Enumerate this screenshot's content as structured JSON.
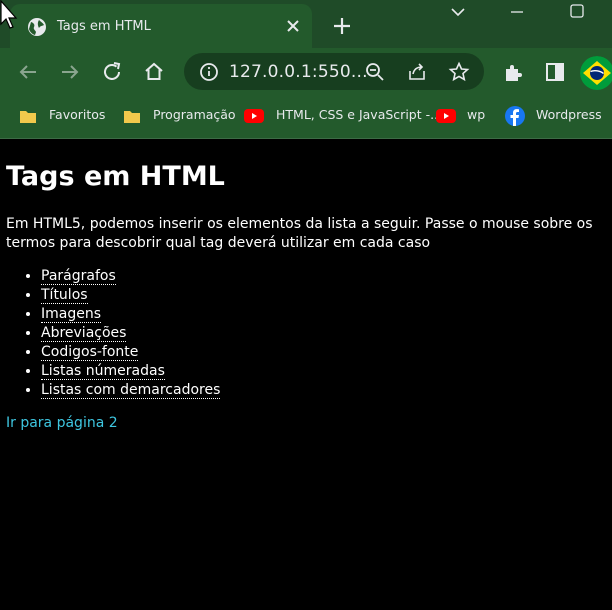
{
  "browser": {
    "tab_title": "Tags em HTML",
    "url": "127.0.0.1:550...",
    "bookmarks": [
      {
        "label": "Favoritos",
        "icon": "folder-icon"
      },
      {
        "label": "Programação",
        "icon": "folder-icon"
      },
      {
        "label": "HTML, CSS e JavaScript -...",
        "icon": "youtube-icon"
      },
      {
        "label": "wp",
        "icon": "youtube-icon"
      },
      {
        "label": "Wordpress",
        "icon": "facebook-icon"
      }
    ],
    "colors": {
      "tabstrip": "#1f4b28",
      "toolbar": "#235a2c",
      "omnibox": "#173e1f"
    }
  },
  "page": {
    "heading": "Tags em HTML",
    "intro": "Em HTML5, podemos inserir os elementos da lista a seguir. Passe o mouse sobre os termos para descobrir qual tag deverá utilizar em cada caso",
    "items": [
      "Parágrafos",
      "Títulos",
      "Imagens",
      "Abreviações",
      "Codigos-fonte",
      "Listas númeradas",
      "Listas com demarcadores"
    ],
    "link": "Ir para página 2",
    "colors": {
      "background": "#000000",
      "text": "#ffffff",
      "link": "#3ec6e0"
    }
  }
}
